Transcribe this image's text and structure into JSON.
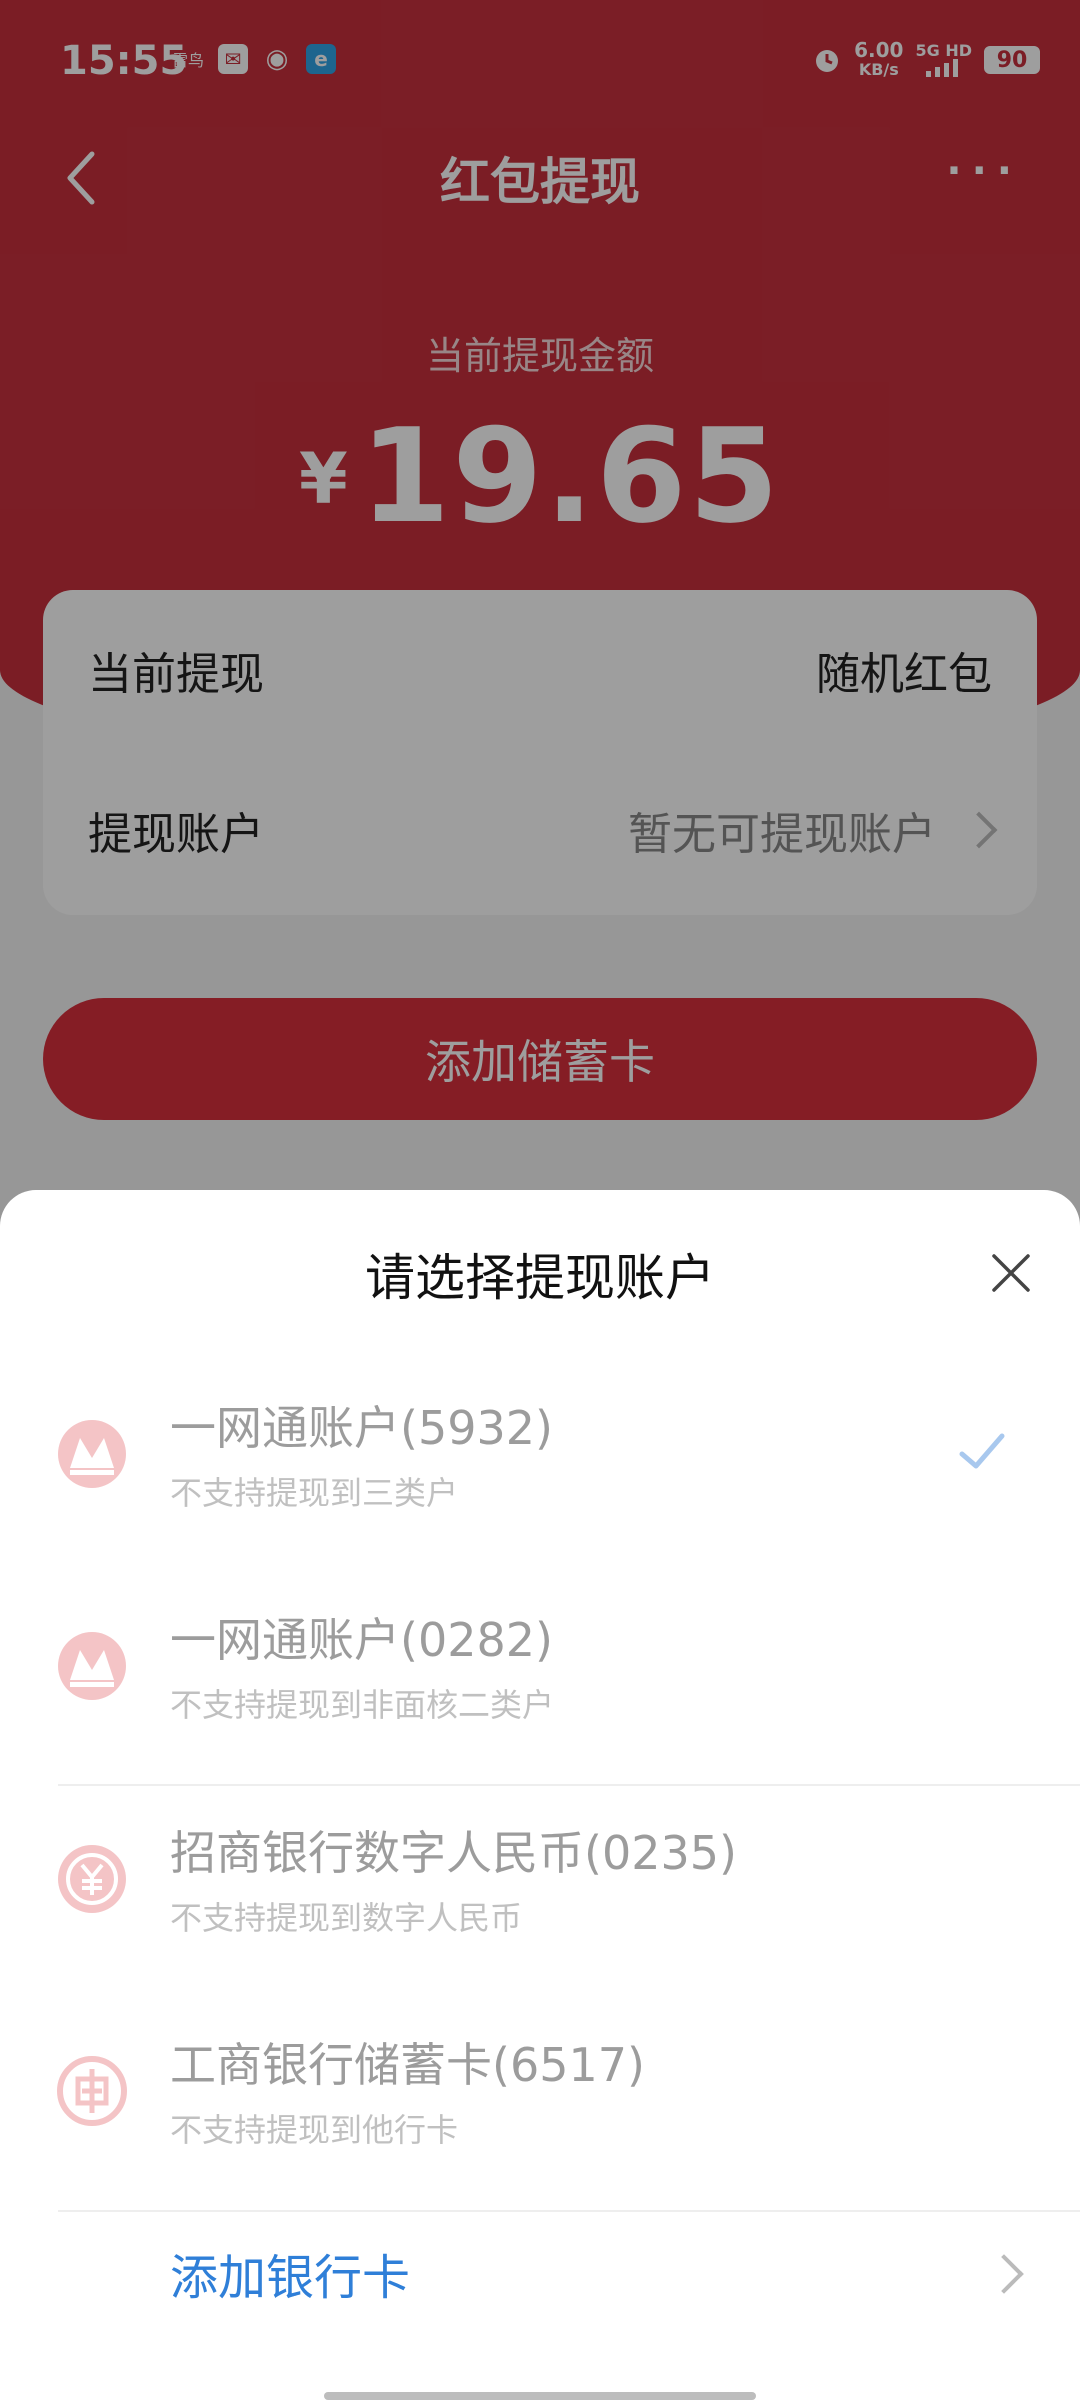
{
  "status_bar": {
    "time": "15:55",
    "notif_text": "雷鸟",
    "net_speed_value": "6.00",
    "net_speed_unit": "KB/s",
    "signal": "5G HD",
    "battery": "90"
  },
  "nav": {
    "title": "红包提现"
  },
  "amount": {
    "label": "当前提现金额",
    "currency": "¥",
    "value": "19.65"
  },
  "card": {
    "row1_label": "当前提现",
    "row1_value": "随机红包",
    "row2_label": "提现账户",
    "row2_value": "暂无可提现账户"
  },
  "add_debit_button": "添加储蓄卡",
  "sheet": {
    "title": "请选择提现账户",
    "accounts": [
      {
        "name": "一网通账户(5932)",
        "desc": "不支持提现到三类户",
        "logo": "cmb-logo-icon",
        "selected": true
      },
      {
        "name": "一网通账户(0282)",
        "desc": "不支持提现到非面核二类户",
        "logo": "cmb-logo-icon",
        "selected": false
      },
      {
        "name": "招商银行数字人民币(0235)",
        "desc": "不支持提现到数字人民币",
        "logo": "ecny-logo-icon",
        "selected": false
      },
      {
        "name": "工商银行储蓄卡(6517)",
        "desc": "不支持提现到他行卡",
        "logo": "icbc-logo-icon",
        "selected": false
      }
    ],
    "add_bank_card": "添加银行卡"
  },
  "colors": {
    "brand_red": "#c7303d",
    "link_blue": "#2f7fd8",
    "check_blue": "#a8c8ee"
  }
}
